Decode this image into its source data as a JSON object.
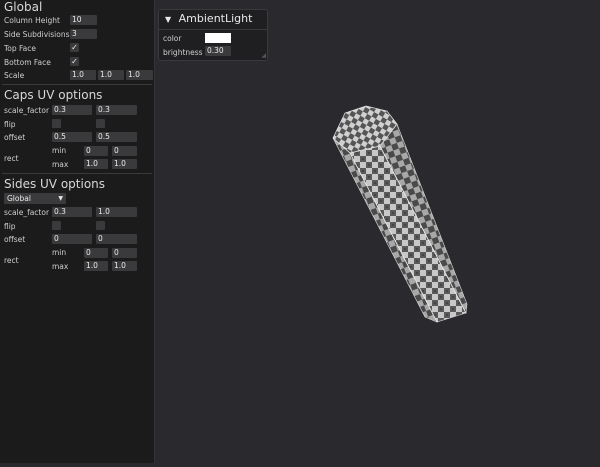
{
  "global": {
    "title": "Global",
    "column_height_label": "Column Height",
    "column_height": "10",
    "side_subdivisions_label": "Side Subdivisions",
    "side_subdivisions": "3",
    "top_face_label": "Top Face",
    "top_face_checked": "✓",
    "bottom_face_label": "Bottom Face",
    "bottom_face_checked": "✓",
    "scale_label": "Scale",
    "scale": [
      "1.0",
      "1.0",
      "1.0"
    ]
  },
  "caps": {
    "title": "Caps UV options",
    "scale_factor_label": "scale_factor",
    "scale_factor": [
      "0.3",
      "0.3"
    ],
    "flip_label": "flip",
    "offset_label": "offset",
    "offset": [
      "0.5",
      "0.5"
    ],
    "rect_label": "rect",
    "min_label": "min",
    "min": [
      "0",
      "0"
    ],
    "max_label": "max",
    "max": [
      "1.0",
      "1.0"
    ]
  },
  "sides": {
    "title": "Sides UV options",
    "mode": "Global",
    "scale_factor_label": "scale_factor",
    "scale_factor": [
      "0.3",
      "1.0"
    ],
    "flip_label": "flip",
    "offset_label": "offset",
    "offset": [
      "0",
      "0"
    ],
    "rect_label": "rect",
    "min_label": "min",
    "min": [
      "0",
      "0"
    ],
    "max_label": "max",
    "max": [
      "1.0",
      "1.0"
    ]
  },
  "ambient_light": {
    "title": "AmbientLight",
    "color_label": "color",
    "color": "#ffffff",
    "brightness_label": "brightness",
    "brightness": "0.30"
  },
  "theme": {
    "background": "#2a2a2e",
    "sidebar": "#1b1b1c",
    "field": "#3a3a3d"
  }
}
